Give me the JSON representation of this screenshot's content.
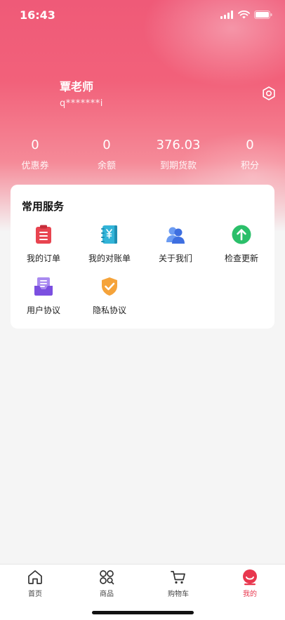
{
  "status_bar": {
    "time": "16:43"
  },
  "profile": {
    "name": "覃老师",
    "account": "q*******i"
  },
  "stats": [
    {
      "value": "0",
      "label": "优惠券"
    },
    {
      "value": "0",
      "label": "余额"
    },
    {
      "value": "376.03",
      "label": "到期货款"
    },
    {
      "value": "0",
      "label": "积分"
    }
  ],
  "services": {
    "title": "常用服务",
    "items": [
      {
        "label": "我的订单",
        "icon": "clipboard-icon",
        "color": "#e84450"
      },
      {
        "label": "我的对账单",
        "icon": "ledger-icon",
        "color": "#32b4d8"
      },
      {
        "label": "关于我们",
        "icon": "users-icon",
        "color": "#4a7fe6"
      },
      {
        "label": "检查更新",
        "icon": "arrow-up-circle-icon",
        "color": "#2bbf6a"
      },
      {
        "label": "用户协议",
        "icon": "inbox-document-icon",
        "color": "#8b5fe0"
      },
      {
        "label": "隐私协议",
        "icon": "shield-check-icon",
        "color": "#f5a33a"
      }
    ]
  },
  "tabbar": {
    "items": [
      {
        "label": "首页",
        "icon": "home-icon"
      },
      {
        "label": "商品",
        "icon": "grid-icon"
      },
      {
        "label": "购物车",
        "icon": "cart-icon"
      },
      {
        "label": "我的",
        "icon": "profile-icon",
        "active": true
      }
    ],
    "active_color": "#e8374e"
  }
}
